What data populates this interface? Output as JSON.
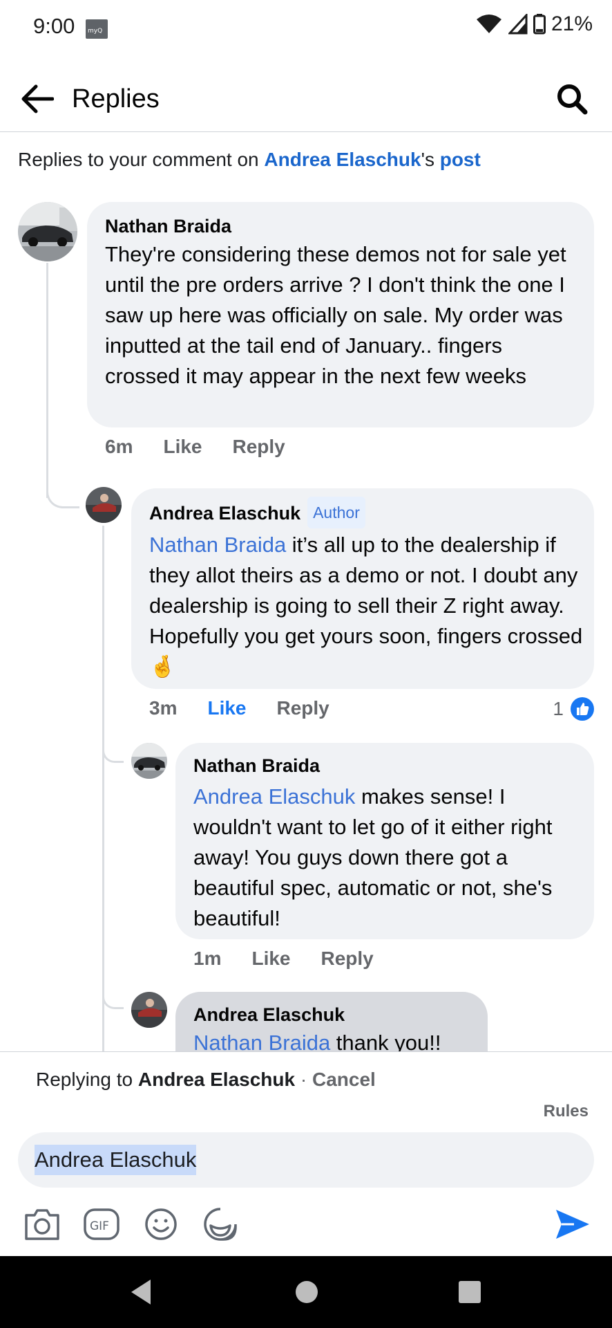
{
  "status": {
    "time": "9:00",
    "badge": "myQ",
    "battery": "21%"
  },
  "header": {
    "title": "Replies"
  },
  "context": {
    "prefix": "Replies to your comment on ",
    "owner": "Andrea Elaschuk",
    "possessive": "'s ",
    "post_link": "post"
  },
  "comments": [
    {
      "author": "Nathan Braida",
      "text": "They're considering these demos not for sale yet until the pre orders arrive ? I don't think the one I saw up here was officially on sale. My order was inputted at the tail end of January.. fingers crossed it may appear in the next few weeks",
      "time": "6m",
      "like": "Like",
      "reply": "Reply"
    },
    {
      "author": "Andrea Elaschuk",
      "badge": "Author",
      "mention": "Nathan Braida",
      "text": "  it’s all up to the dealership if they allot theirs as a demo or not. I doubt any dealership is going to sell their Z right away. Hopefully you get yours soon, fingers crossed",
      "emoji": "🤞",
      "time": "3m",
      "like": "Like",
      "reply": "Reply",
      "like_count": "1"
    },
    {
      "author": "Nathan Braida",
      "mention": "Andrea Elaschuk",
      "text": " makes sense! I wouldn't want to let go of it either right away! You guys down there got a beautiful spec, automatic or not, she's beautiful!",
      "time": "1m",
      "like": "Like",
      "reply": "Reply"
    },
    {
      "author": "Andrea Elaschuk",
      "mention": "Nathan Braida",
      "text": " thank you!!"
    }
  ],
  "reply_bar": {
    "replying_prefix": "Replying to ",
    "replying_to": "Andrea Elaschuk",
    "separator": " · ",
    "cancel": "Cancel",
    "rules": "Rules",
    "input_value": "Andrea Elaschuk"
  },
  "icons": {
    "back": "arrow-left",
    "search": "magnifier",
    "camera": "camera",
    "gif": "GIF",
    "emoji": "smiley",
    "sticker": "sticker",
    "send": "paper-plane"
  },
  "colors": {
    "link": "#1a66cc",
    "mention": "#3b72d6",
    "like_active": "#1877f2",
    "bubble": "#f0f2f5"
  }
}
